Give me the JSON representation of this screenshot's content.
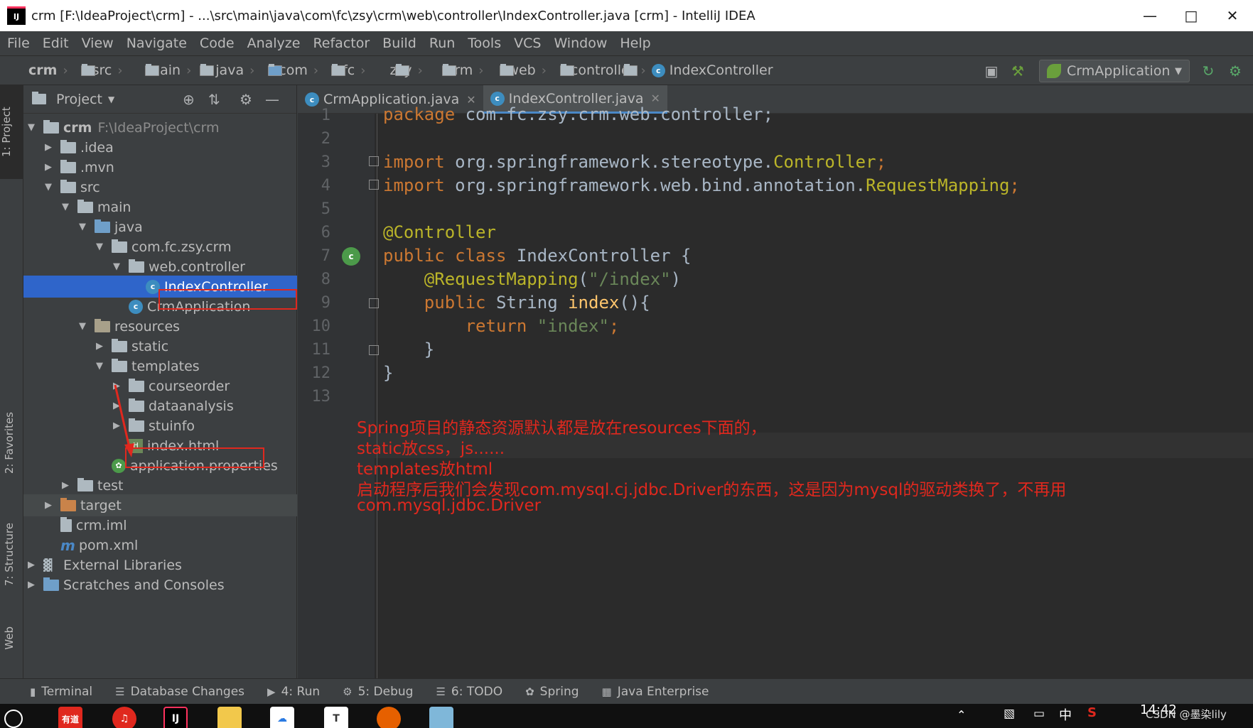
{
  "window": {
    "title": "crm [F:\\IdeaProject\\crm] - ...\\src\\main\\java\\com\\fc\\zsy\\crm\\web\\controller\\IndexController.java [crm] - IntelliJ IDEA",
    "logo_text": "IJ"
  },
  "menu": [
    "File",
    "Edit",
    "View",
    "Navigate",
    "Code",
    "Analyze",
    "Refactor",
    "Build",
    "Run",
    "Tools",
    "VCS",
    "Window",
    "Help"
  ],
  "breadcrumb": [
    "crm",
    "src",
    "main",
    "java",
    "com",
    "fc",
    "zsy",
    "crm",
    "web",
    "controller",
    "IndexController"
  ],
  "run_config": "CrmApplication",
  "left_tabs": {
    "project": "1: Project",
    "favorites": "2: Favorites",
    "structure": "7: Structure",
    "web": "Web"
  },
  "project_panel": {
    "title": "Project",
    "tree": [
      {
        "label": "crm",
        "extra": "F:\\IdeaProject\\crm"
      },
      {
        "label": ".idea"
      },
      {
        "label": ".mvn"
      },
      {
        "label": "src"
      },
      {
        "label": "main"
      },
      {
        "label": "java"
      },
      {
        "label": "com.fc.zsy.crm"
      },
      {
        "label": "web.controller"
      },
      {
        "label": "IndexController"
      },
      {
        "label": "CrmApplication"
      },
      {
        "label": "resources"
      },
      {
        "label": "static"
      },
      {
        "label": "templates"
      },
      {
        "label": "courseorder"
      },
      {
        "label": "dataanalysis"
      },
      {
        "label": "stuinfo"
      },
      {
        "label": "index.html"
      },
      {
        "label": "application.properties"
      },
      {
        "label": "test"
      },
      {
        "label": "target"
      },
      {
        "label": "crm.iml"
      },
      {
        "label": "pom.xml"
      },
      {
        "label": "External Libraries"
      },
      {
        "label": "Scratches and Consoles"
      }
    ]
  },
  "editor_tabs": [
    "CrmApplication.java",
    "IndexController.java"
  ],
  "code": {
    "line_numbers": [
      "1",
      "2",
      "3",
      "4",
      "5",
      "6",
      "7",
      "8",
      "9",
      "10",
      "11",
      "12",
      "13"
    ],
    "l1a": "package",
    "l1b": " com.fc.zsy.crm.web.controller;",
    "l3a": "import",
    "l3b": " org.springframework.stereotype.",
    "l3c": "Controller",
    "l3d": ";",
    "l4a": "import",
    "l4b": " org.springframework.web.bind.annotation.",
    "l4c": "RequestMapping",
    "l4d": ";",
    "l6": "@Controller",
    "l7a": "public class",
    "l7b": " IndexController {",
    "l8a": "    @RequestMapping",
    "l8b": "(",
    "l8c": "\"/index\"",
    "l8d": ")",
    "l9a": "    public",
    "l9b": " String ",
    "l9c": "index",
    "l9d": "(){",
    "l10a": "        return",
    "l10b": " ",
    "l10c": "\"index\"",
    "l10d": ";",
    "l11": "    }",
    "l12": "}"
  },
  "annotation_notes": [
    "Spring项目的静态资源默认都是放在resources下面的，",
    "static放css，js......",
    "templates放html",
    "启动程序后我们会发现com.mysql.cj.jdbc.Driver的东西，这是因为mysql的驱动类换了，不再用",
    "com.mysql.jdbc.Driver"
  ],
  "bottom_tools": [
    {
      "label": "Terminal",
      "icon": "terminal-icon"
    },
    {
      "label": "Database Changes",
      "icon": "database-icon"
    },
    {
      "label": "4: Run",
      "icon": "run-icon"
    },
    {
      "label": "5: Debug",
      "icon": "bug-icon"
    },
    {
      "label": "6: TODO",
      "icon": "todo-icon"
    },
    {
      "label": "Spring",
      "icon": "spring-icon"
    },
    {
      "label": "Java Enterprise",
      "icon": "java-ee-icon"
    }
  ],
  "taskbar": {
    "time": "14:42",
    "watermark": "CSDN @墨染lily",
    "ime": "中",
    "apps": [
      "有道",
      "IJ",
      "T"
    ]
  }
}
